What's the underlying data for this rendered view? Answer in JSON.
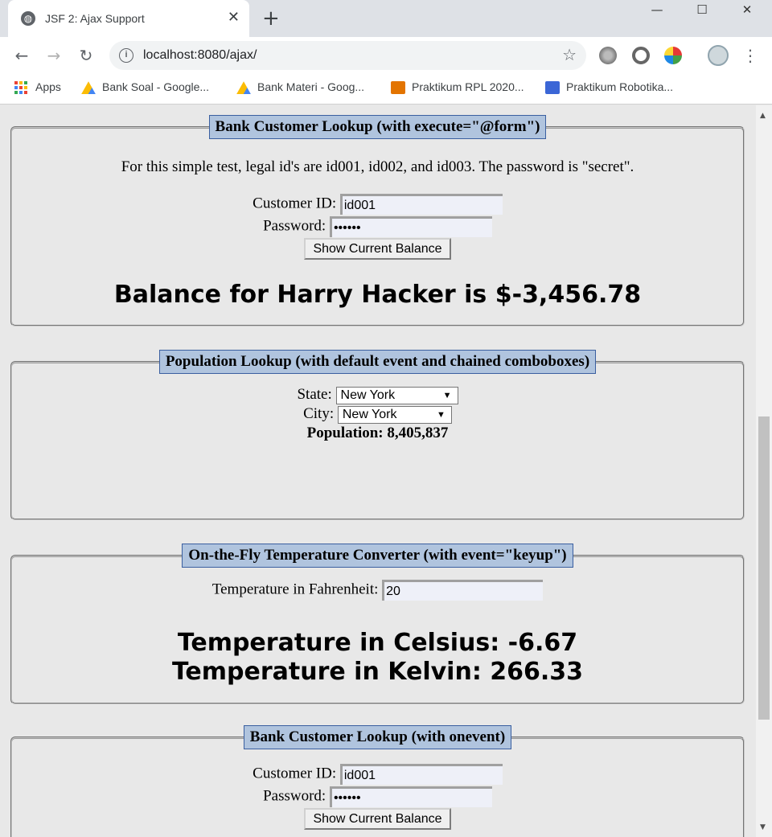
{
  "browser": {
    "tab_title": "JSF 2: Ajax Support",
    "url": "localhost:8080/ajax/",
    "new_tab": "+",
    "tab_close": "✕",
    "bookmarks": [
      {
        "label": "Apps",
        "icon": "apps-grid-icon"
      },
      {
        "label": "Bank Soal - Google...",
        "icon": "google-drive-icon"
      },
      {
        "label": "Bank Materi - Goog...",
        "icon": "google-drive-icon"
      },
      {
        "label": "Praktikum RPL 2020...",
        "icon": "classroom-icon"
      },
      {
        "label": "Praktikum Robotika...",
        "icon": "classroom-icon"
      }
    ]
  },
  "panel1": {
    "title": "Bank Customer Lookup (with execute=\"@form\")",
    "intro": "For this simple test, legal id's are id001, id002, and id003. The password is \"secret\".",
    "customer_id_label": "Customer ID:",
    "customer_id_value": "id001",
    "password_label": "Password:",
    "password_value": "••••••",
    "button_label": "Show Current Balance",
    "result": "Balance for Harry Hacker is $-3,456.78"
  },
  "panel2": {
    "title": "Population Lookup (with default event and chained comboboxes)",
    "state_label": "State:",
    "state_value": "New York",
    "city_label": "City:",
    "city_value": "New York",
    "population_text": "Population: 8,405,837"
  },
  "panel3": {
    "title": "On-the-Fly Temperature Converter (with event=\"keyup\")",
    "fahrenheit_label": "Temperature in Fahrenheit:",
    "fahrenheit_value": "20",
    "celsius_text": "Temperature in Celsius: -6.67",
    "kelvin_text": "Temperature in Kelvin: 266.33"
  },
  "panel4": {
    "title": "Bank Customer Lookup (with onevent)",
    "customer_id_label": "Customer ID:",
    "customer_id_value": "id001",
    "password_label": "Password:",
    "password_value": "••••••",
    "button_label": "Show Current Balance"
  }
}
